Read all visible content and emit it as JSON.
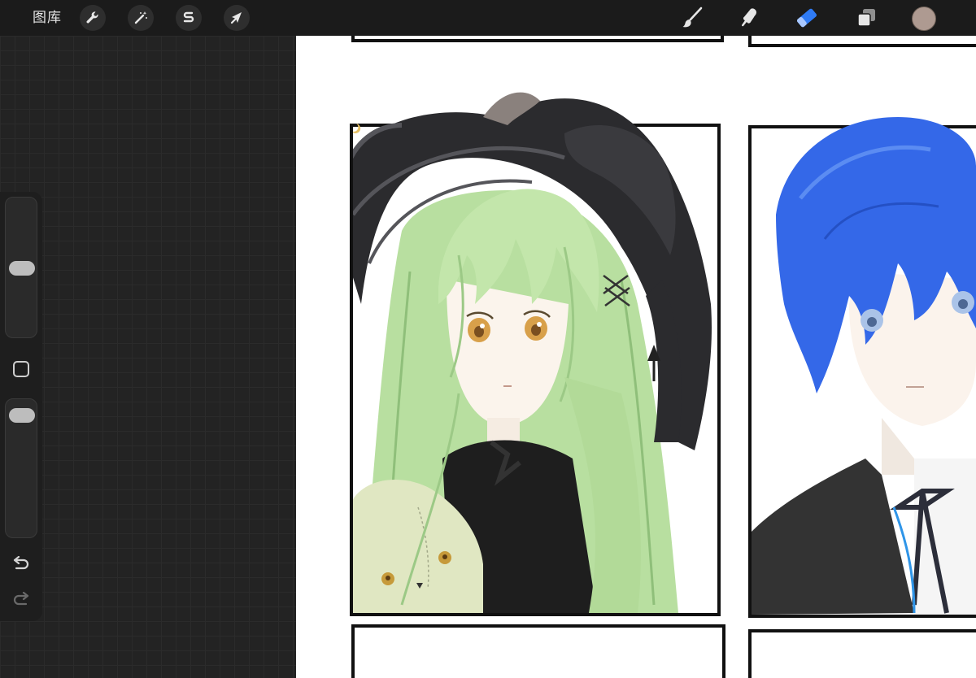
{
  "toolbar": {
    "gallery_label": "图库",
    "left_tools": [
      {
        "name": "actions",
        "icon": "wrench-icon"
      },
      {
        "name": "adjustments",
        "icon": "magic-wand-icon"
      },
      {
        "name": "selection",
        "icon": "selection-s-icon"
      },
      {
        "name": "transform",
        "icon": "arrow-cursor-icon"
      }
    ],
    "right_tools": [
      {
        "name": "brush",
        "icon": "brush-icon"
      },
      {
        "name": "smudge",
        "icon": "smudge-icon"
      },
      {
        "name": "eraser",
        "icon": "eraser-icon",
        "active": true
      },
      {
        "name": "layers",
        "icon": "layers-icon"
      }
    ],
    "active_tool_color": "#2f7bf5",
    "current_color": "#ae9a91"
  },
  "sidebar": {
    "brush_size_level": 0.5,
    "opacity_level": 0.95,
    "modifier_icon": "square-modifier-icon",
    "undo_icon": "undo-icon",
    "redo_icon": "redo-icon"
  },
  "canvas": {
    "background": "#ffffff",
    "panels": [
      {
        "name": "green-hair-girl-panel",
        "hair_color": "#b6de9e"
      },
      {
        "name": "blue-hair-boy-panel",
        "hair_color": "#2f63e6"
      }
    ]
  }
}
